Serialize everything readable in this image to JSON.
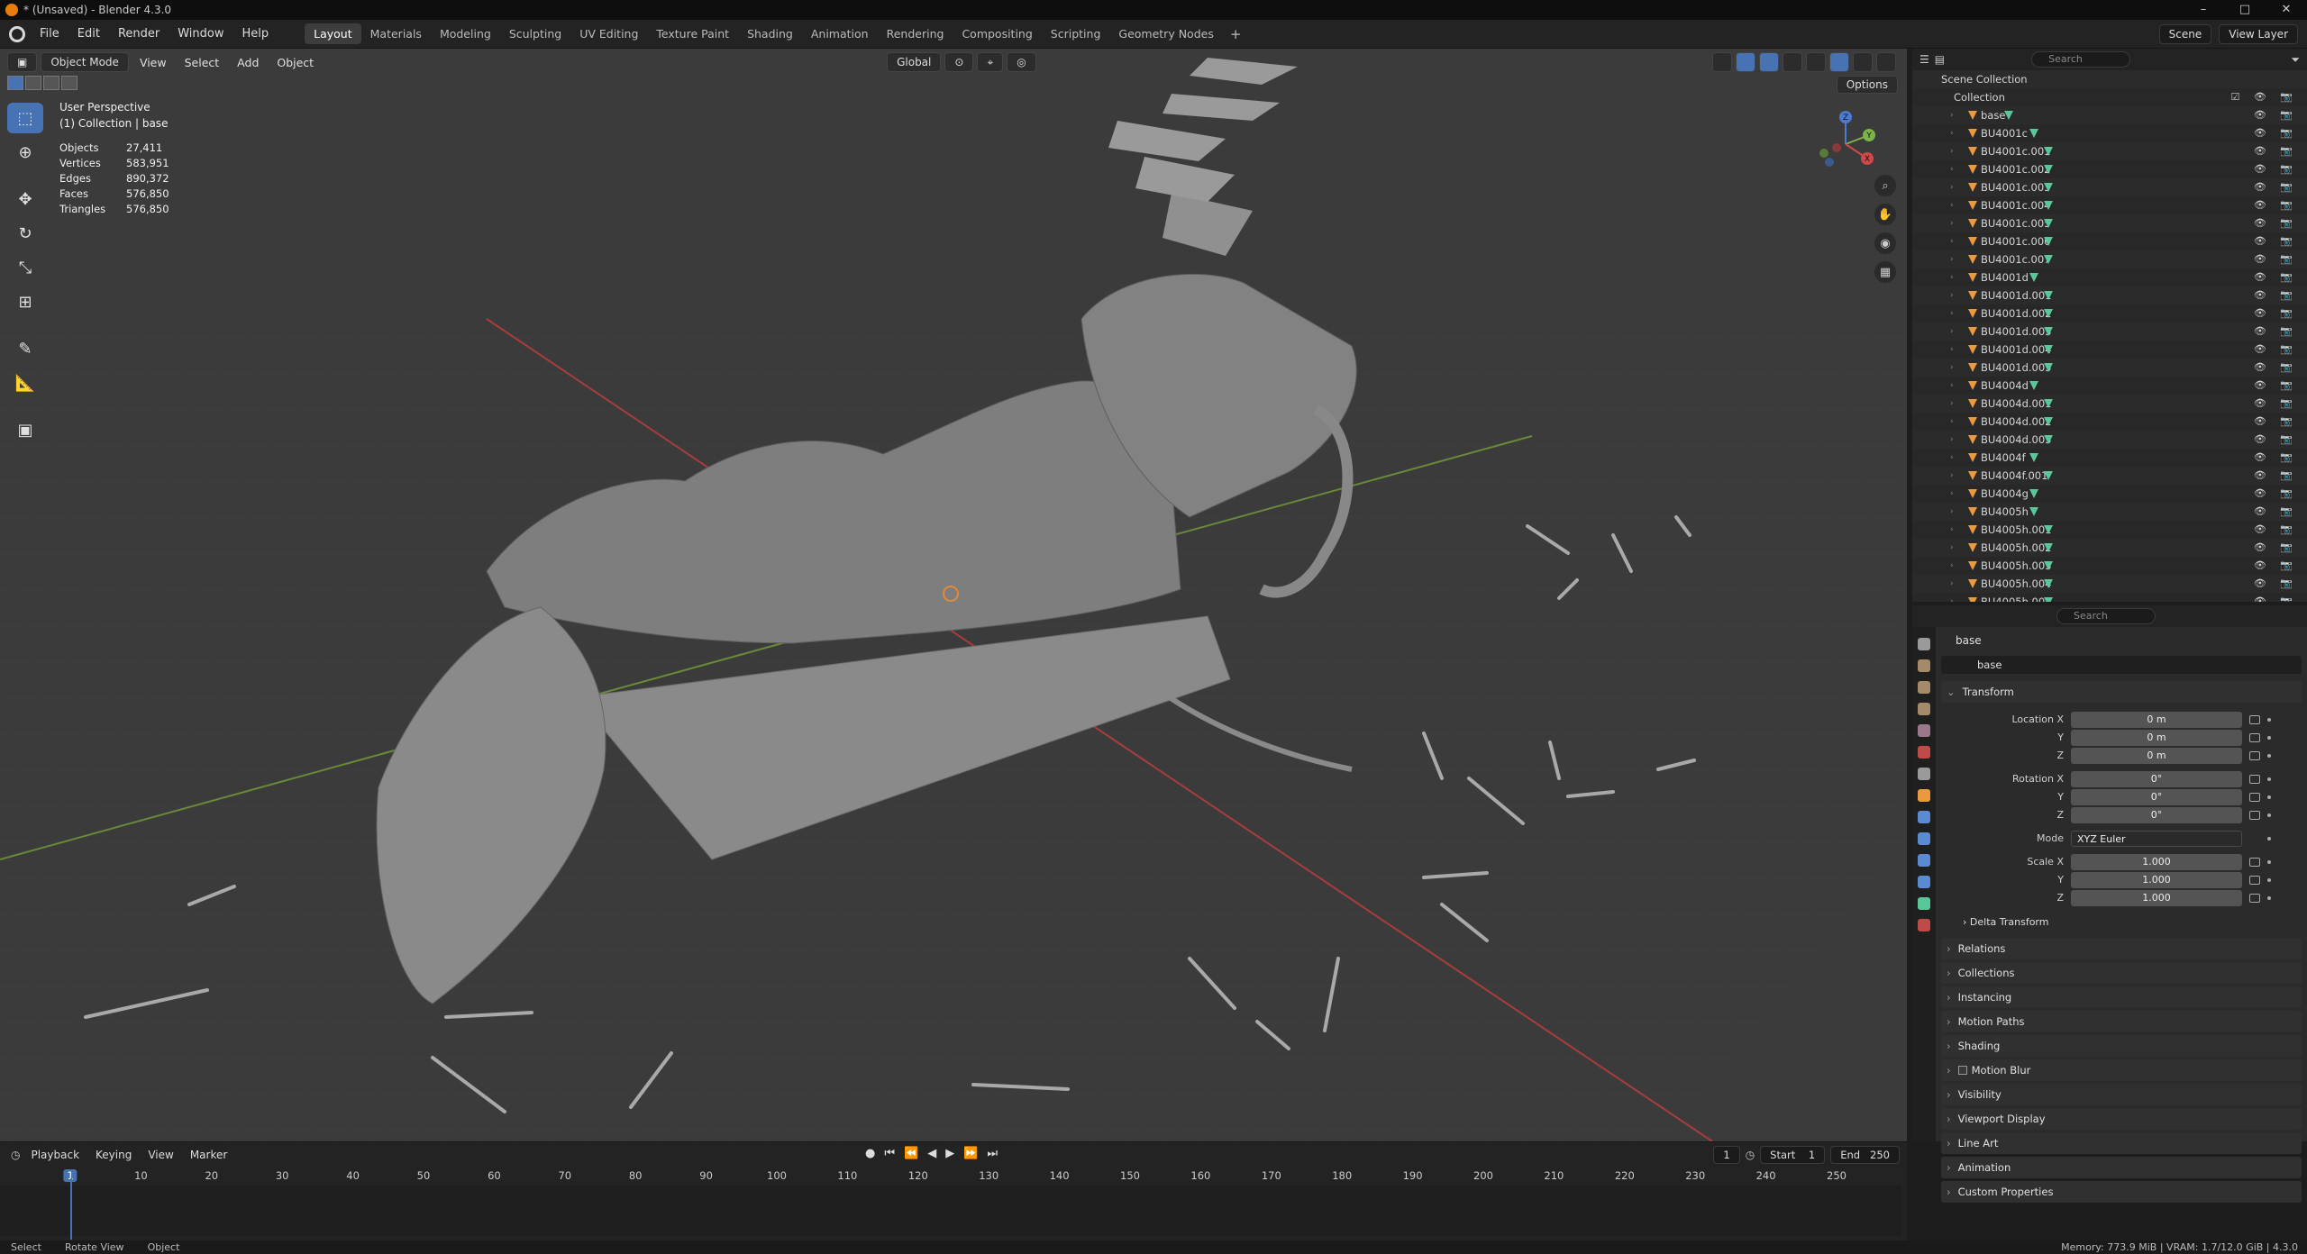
{
  "window": {
    "title": "* (Unsaved) - Blender 4.3.0",
    "controls": [
      "–",
      "□",
      "✕"
    ]
  },
  "menubar": {
    "menus": [
      "File",
      "Edit",
      "Render",
      "Window",
      "Help"
    ],
    "workspaces": [
      "Layout",
      "Materials",
      "Modeling",
      "Sculpting",
      "UV Editing",
      "Texture Paint",
      "Shading",
      "Animation",
      "Rendering",
      "Compositing",
      "Scripting",
      "Geometry Nodes"
    ],
    "active_workspace": "Layout",
    "add_workspace": "+",
    "scene": "Scene",
    "view_layer": "View Layer"
  },
  "viewport": {
    "mode": "Object Mode",
    "menus": [
      "View",
      "Select",
      "Add",
      "Object"
    ],
    "orientation": "Global",
    "options": "Options",
    "perspective_label": "User Perspective",
    "context_label": "(1) Collection | base",
    "stats": [
      {
        "label": "Objects",
        "value": "27,411"
      },
      {
        "label": "Vertices",
        "value": "583,951"
      },
      {
        "label": "Edges",
        "value": "890,372"
      },
      {
        "label": "Faces",
        "value": "576,850"
      },
      {
        "label": "Triangles",
        "value": "576,850"
      }
    ],
    "tools": [
      "select-box",
      "cursor",
      "move",
      "rotate",
      "scale",
      "transform",
      "annotate",
      "measure",
      "add-cube"
    ],
    "gizmo_axes": {
      "x": "X",
      "y": "Y",
      "z": "Z"
    }
  },
  "outliner": {
    "search_placeholder": "Search",
    "scene_collection": "Scene Collection",
    "collection": "Collection",
    "objects": [
      "base",
      "BU4001c",
      "BU4001c.001",
      "BU4001c.002",
      "BU4001c.003",
      "BU4001c.004",
      "BU4001c.005",
      "BU4001c.006",
      "BU4001c.007",
      "BU4001d",
      "BU4001d.001",
      "BU4001d.002",
      "BU4001d.003",
      "BU4001d.004",
      "BU4001d.005",
      "BU4004d",
      "BU4004d.001",
      "BU4004d.002",
      "BU4004d.003",
      "BU4004f",
      "BU4004f.001",
      "BU4004g",
      "BU4005h",
      "BU4005h.001",
      "BU4005h.002",
      "BU4005h.003",
      "BU4005h.004",
      "BU4005h.005"
    ]
  },
  "properties": {
    "search_placeholder": "Search",
    "object_title": "base",
    "object_name": "base",
    "transform_label": "Transform",
    "location": {
      "label_x": "Location X",
      "x": "0 m",
      "y": "0 m",
      "z": "0 m"
    },
    "rotation": {
      "label_x": "Rotation X",
      "x": "0°",
      "y": "0°",
      "z": "0°"
    },
    "mode": {
      "label": "Mode",
      "value": "XYZ Euler"
    },
    "scale": {
      "label_x": "Scale X",
      "x": "1.000",
      "y": "1.000",
      "z": "1.000"
    },
    "axis_labels": {
      "y": "Y",
      "z": "Z"
    },
    "delta_transform": "Delta Transform",
    "panels": [
      "Relations",
      "Collections",
      "Instancing",
      "Motion Paths",
      "Shading",
      "Motion Blur",
      "Visibility",
      "Viewport Display",
      "Line Art",
      "Animation",
      "Custom Properties"
    ]
  },
  "timeline": {
    "menus": [
      "Playback",
      "Keying",
      "View",
      "Marker"
    ],
    "current_frame": "1",
    "start_label": "Start",
    "start": "1",
    "end_label": "End",
    "end": "250",
    "ticks": [
      "1",
      "10",
      "20",
      "30",
      "40",
      "50",
      "60",
      "70",
      "80",
      "90",
      "100",
      "110",
      "120",
      "130",
      "140",
      "150",
      "160",
      "170",
      "180",
      "190",
      "200",
      "210",
      "220",
      "230",
      "240",
      "250"
    ]
  },
  "statusbar": {
    "hints": [
      "Select",
      "Rotate View",
      "Object"
    ],
    "info": "Memory: 773.9 MiB | VRAM: 1.7/12.0 GiB | 4.3.0"
  }
}
